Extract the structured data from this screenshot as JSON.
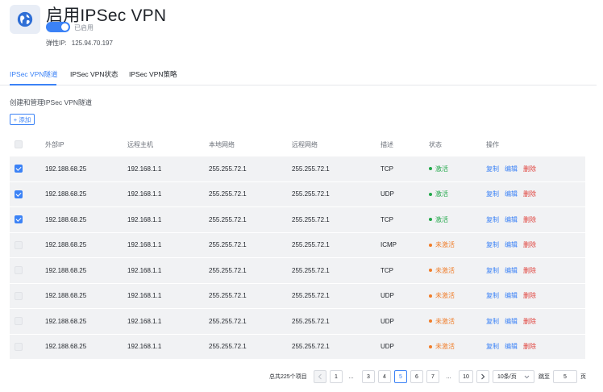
{
  "header": {
    "title": "启用IPSec VPN",
    "toggle_label": "已启用",
    "eip_label": "弹性IP:",
    "eip_value": "125.94.70.197"
  },
  "tabs": [
    {
      "label": "IPSec VPN隧道",
      "active": true
    },
    {
      "label": "IPSec VPN状态",
      "active": false
    },
    {
      "label": "IPSec VPN策略",
      "active": false
    }
  ],
  "section": {
    "description": "创建和管理IPSec VPN隧道",
    "add_label": "+ 添加"
  },
  "table": {
    "columns": [
      "外部IP",
      "远程主机",
      "本地网络",
      "远程网络",
      "描述",
      "状态",
      "操作"
    ],
    "rows": [
      {
        "checked": true,
        "ext_ip": "192.188.68.25",
        "remote_host": "192.168.1.1",
        "local_net": "255.255.72.1",
        "remote_net": "255.255.72.1",
        "desc": "TCP",
        "status": "激活",
        "status_color": "#22a84a"
      },
      {
        "checked": true,
        "ext_ip": "192.188.68.25",
        "remote_host": "192.168.1.1",
        "local_net": "255.255.72.1",
        "remote_net": "255.255.72.1",
        "desc": "UDP",
        "status": "激活",
        "status_color": "#22a84a"
      },
      {
        "checked": true,
        "ext_ip": "192.188.68.25",
        "remote_host": "192.168.1.1",
        "local_net": "255.255.72.1",
        "remote_net": "255.255.72.1",
        "desc": "TCP",
        "status": "激活",
        "status_color": "#22a84a"
      },
      {
        "checked": false,
        "ext_ip": "192.188.68.25",
        "remote_host": "192.168.1.1",
        "local_net": "255.255.72.1",
        "remote_net": "255.255.72.1",
        "desc": "ICMP",
        "status": "未激活",
        "status_color": "#f07d2a"
      },
      {
        "checked": false,
        "ext_ip": "192.188.68.25",
        "remote_host": "192.168.1.1",
        "local_net": "255.255.72.1",
        "remote_net": "255.255.72.1",
        "desc": "TCP",
        "status": "未激活",
        "status_color": "#f07d2a"
      },
      {
        "checked": false,
        "ext_ip": "192.188.68.25",
        "remote_host": "192.168.1.1",
        "local_net": "255.255.72.1",
        "remote_net": "255.255.72.1",
        "desc": "UDP",
        "status": "未激活",
        "status_color": "#f07d2a"
      },
      {
        "checked": false,
        "ext_ip": "192.188.68.25",
        "remote_host": "192.168.1.1",
        "local_net": "255.255.72.1",
        "remote_net": "255.255.72.1",
        "desc": "UDP",
        "status": "未激活",
        "status_color": "#f07d2a"
      },
      {
        "checked": false,
        "ext_ip": "192.188.68.25",
        "remote_host": "192.168.1.1",
        "local_net": "255.255.72.1",
        "remote_net": "255.255.72.1",
        "desc": "UDP",
        "status": "未激活",
        "status_color": "#f07d2a"
      }
    ],
    "ops": {
      "copy": "复制",
      "edit": "编辑",
      "delete": "删除"
    }
  },
  "pagination": {
    "total_text": "总共225个项目",
    "prev_icon": "chevron-left-icon",
    "next_icon": "chevron-right-icon",
    "pages": [
      "1",
      "…",
      "3",
      "4",
      "5",
      "6",
      "7",
      "…",
      "10"
    ],
    "current": "5",
    "page_size": "10条/页",
    "jump_label": "跳至",
    "jump_value": "5",
    "page_unit": "页"
  },
  "colors": {
    "accent": "#3b82f6",
    "danger": "#e0403a",
    "active": "#22a84a",
    "inactive": "#f07d2a"
  }
}
